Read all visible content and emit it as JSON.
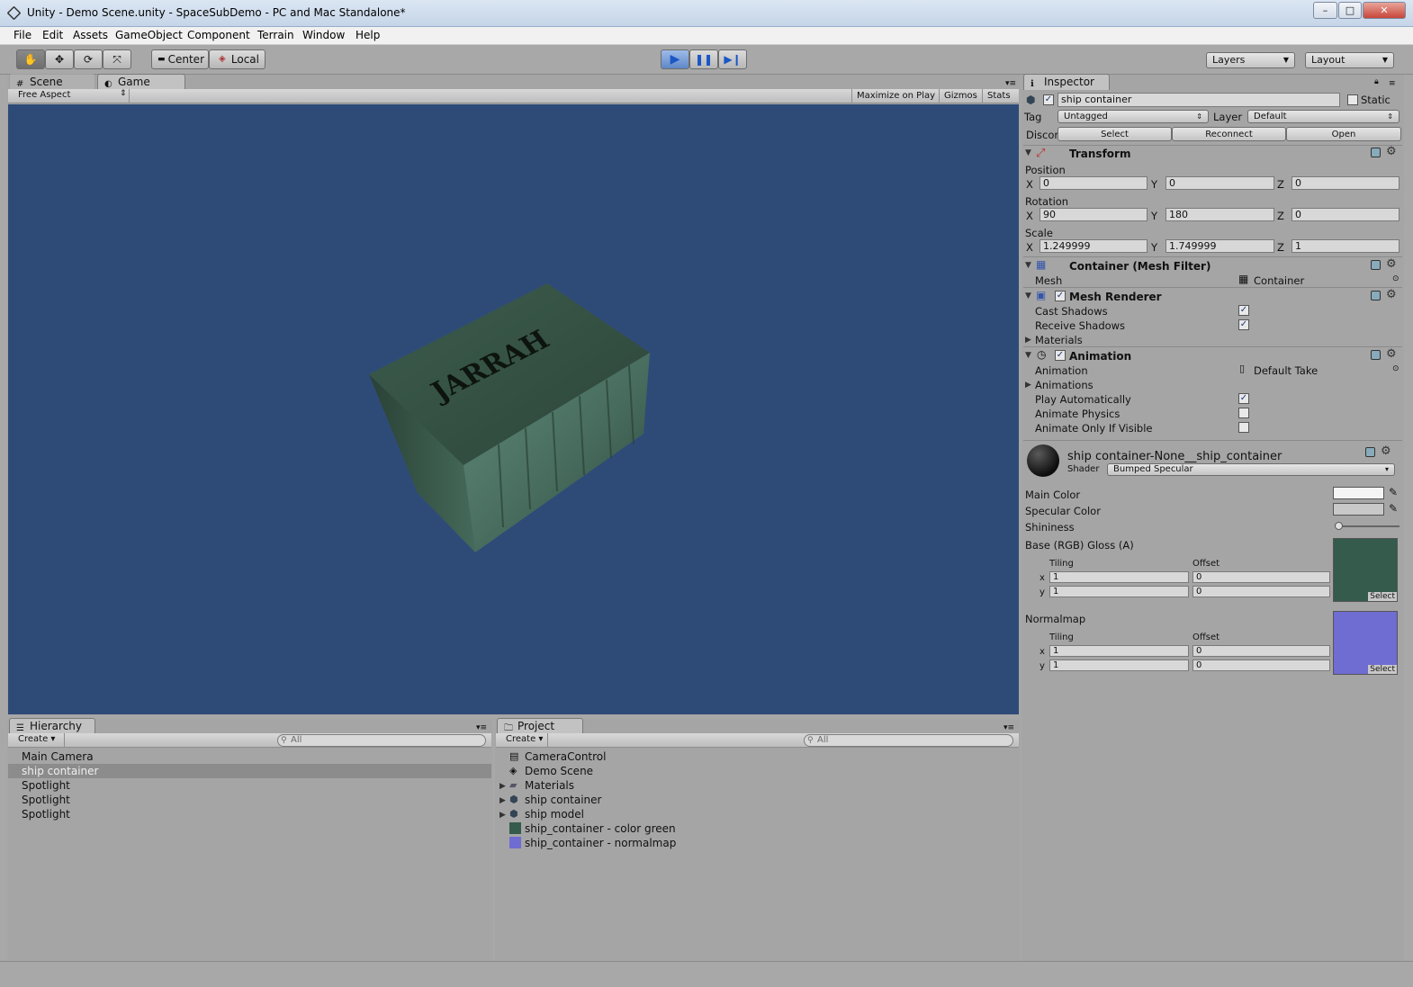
{
  "window": {
    "title": "Unity - Demo Scene.unity - SpaceSubDemo - PC and Mac Standalone*",
    "min": "–",
    "max": "□",
    "close": "✕"
  },
  "menu": [
    "File",
    "Edit",
    "Assets",
    "GameObject",
    "Component",
    "Terrain",
    "Window",
    "Help"
  ],
  "toolbar": {
    "pivot": "Center",
    "space": "Local",
    "layers": "Layers",
    "layout": "Layout"
  },
  "tabs": {
    "scene": "Scene",
    "game": "Game",
    "inspector": "Inspector",
    "hierarchy": "Hierarchy",
    "project": "Project"
  },
  "game": {
    "aspect": "Free Aspect",
    "maximize": "Maximize on Play",
    "gizmos": "Gizmos",
    "stats": "Stats",
    "crate_label": "JARRAH"
  },
  "hierarchy": {
    "create": "Create",
    "search": "All",
    "items": [
      "Main Camera",
      "ship container",
      "Spotlight",
      "Spotlight",
      "Spotlight"
    ]
  },
  "project": {
    "create": "Create",
    "search": "All",
    "items": [
      "CameraControl",
      "Demo Scene",
      "Materials",
      "ship container",
      "ship model",
      "ship_container - color green",
      "ship_container - normalmap"
    ]
  },
  "inspector": {
    "name": "ship container",
    "static": "Static",
    "tag_label": "Tag",
    "tag": "Untagged",
    "layer_label": "Layer",
    "layer": "Default",
    "prefab_label": "Discor",
    "select": "Select",
    "reconnect": "Reconnect",
    "open": "Open",
    "transform": {
      "title": "Transform",
      "position": "Position",
      "rotation": "Rotation",
      "scale": "Scale",
      "pos": [
        "0",
        "0",
        "0"
      ],
      "rot": [
        "90",
        "180",
        "0"
      ],
      "scl": [
        "1.249999",
        "1.749999",
        "1"
      ],
      "axes": [
        "X",
        "Y",
        "Z"
      ]
    },
    "meshfilter": {
      "title": "Container (Mesh Filter)",
      "mesh_label": "Mesh",
      "mesh": "Container"
    },
    "meshrenderer": {
      "title": "Mesh Renderer",
      "cast": "Cast Shadows",
      "receive": "Receive Shadows",
      "materials": "Materials"
    },
    "animation": {
      "title": "Animation",
      "anim_label": "Animation",
      "anim": "Default Take",
      "animations": "Animations",
      "play": "Play Automatically",
      "physics": "Animate Physics",
      "visible": "Animate Only If Visible"
    },
    "material": {
      "name": "ship container-None__ship_container",
      "shader_label": "Shader",
      "shader": "Bumped Specular",
      "main": "Main Color",
      "spec": "Specular Color",
      "shin": "Shininess",
      "base": "Base (RGB) Gloss (A)",
      "normal": "Normalmap",
      "tiling": "Tiling",
      "offset": "Offset",
      "x": "x",
      "y": "y",
      "t1": [
        "1",
        "1"
      ],
      "o1": [
        "0",
        "0"
      ],
      "t2": [
        "1",
        "1"
      ],
      "o2": [
        "0",
        "0"
      ],
      "select": "Select"
    }
  }
}
